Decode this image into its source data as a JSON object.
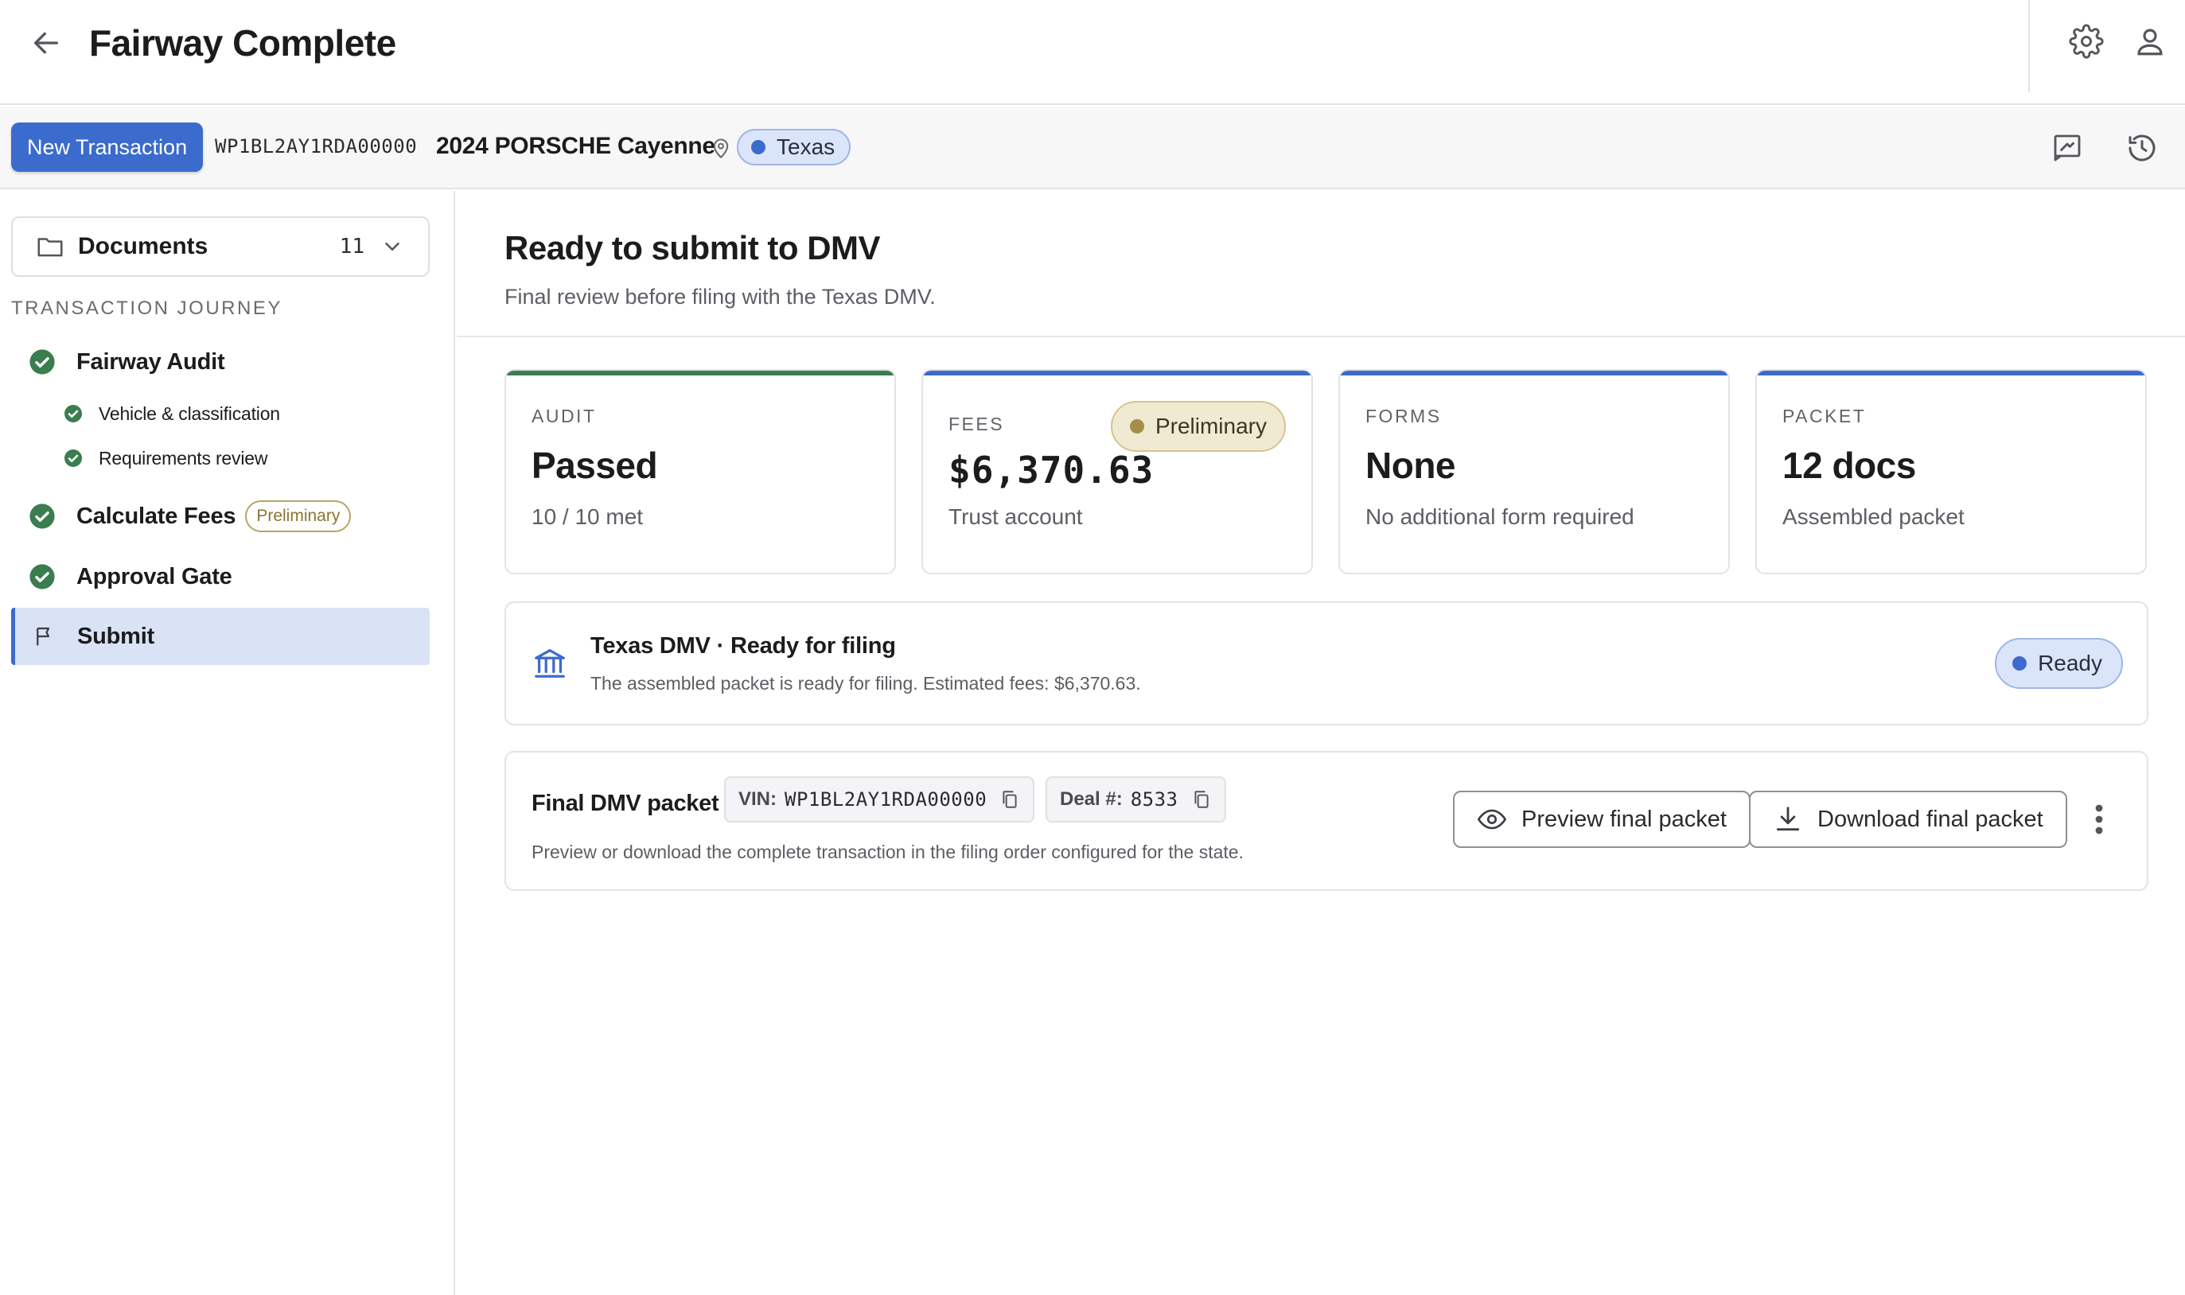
{
  "header": {
    "title": "Fairway Complete",
    "icons": {
      "back": "arrow-left-icon",
      "settings": "gear-icon",
      "account": "user-icon"
    }
  },
  "subheader": {
    "new_transaction_label": "New Transaction",
    "vin": "WP1BL2AY1RDA00000",
    "vehicle": "2024 PORSCHE Cayenne",
    "state": "Texas",
    "icons": {
      "location": "map-pin-icon",
      "notes": "notes-icon",
      "history": "history-icon"
    }
  },
  "sidebar": {
    "documents": {
      "label": "Documents",
      "count": "11"
    },
    "journey_heading": "TRANSACTION JOURNEY",
    "steps": [
      {
        "label": "Fairway Audit",
        "status": "complete"
      },
      {
        "label": "Vehicle & classification",
        "status": "complete"
      },
      {
        "label": "Requirements review",
        "status": "complete"
      },
      {
        "label": "Calculate Fees",
        "status": "complete",
        "badge": "Preliminary"
      },
      {
        "label": "Approval Gate",
        "status": "complete"
      },
      {
        "label": "Submit",
        "status": "active"
      }
    ]
  },
  "main": {
    "title": "Ready to submit to DMV",
    "subtitle": "Final review before filing with the Texas DMV.",
    "cards": [
      {
        "label": "AUDIT",
        "value": "Passed",
        "sub": "10 / 10 met",
        "accent": "#3a7d4f"
      },
      {
        "label": "FEES",
        "value": "$6,370.63",
        "sub": "Trust account",
        "badge": "Preliminary",
        "accent": "#3b6bcd"
      },
      {
        "label": "FORMS",
        "value": "None",
        "sub": "No additional form required",
        "accent": "#3b6bcd"
      },
      {
        "label": "PACKET",
        "value": "12 docs",
        "sub": "Assembled packet",
        "accent": "#3b6bcd"
      }
    ],
    "filing": {
      "title": "Texas DMV · Ready for filing",
      "description": "The assembled packet is ready for filing. Estimated fees: $6,370.63.",
      "status": "Ready"
    },
    "packet": {
      "title": "Final DMV packet",
      "vin_label": "VIN:",
      "vin": "WP1BL2AY1RDA00000",
      "deal_label": "Deal #:",
      "deal": "8533",
      "description": "Preview or download the complete transaction in the filing order configured for the state.",
      "preview_label": "Preview final packet",
      "download_label": "Download final packet"
    }
  },
  "colors": {
    "primary": "#3b6bcd",
    "success": "#3a7d4f",
    "preliminary": "#a68d4a",
    "active_step_bg": "#d9e3f5"
  }
}
